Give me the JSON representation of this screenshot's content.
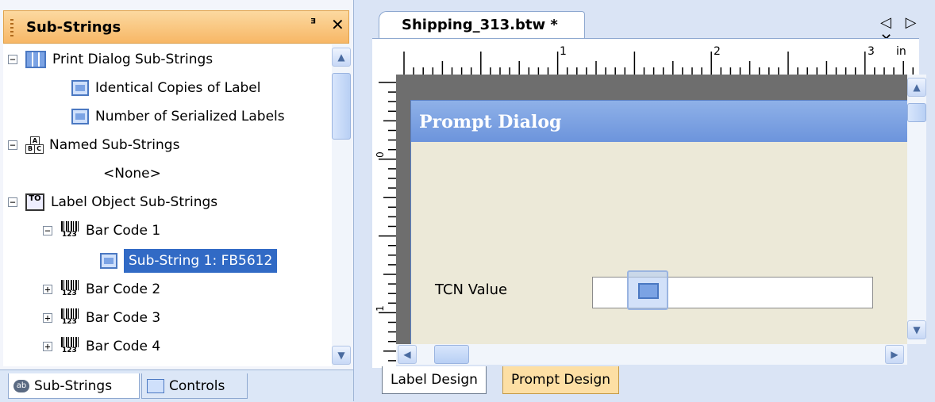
{
  "panel": {
    "title": "Sub-Strings",
    "pin_glyph": "ɰ",
    "close_glyph": "✕"
  },
  "tree": {
    "items": [
      {
        "label": "Print Dialog Sub-Strings",
        "icon": "print-dialog-icon",
        "expander": "−"
      },
      {
        "label": "Identical Copies of Label",
        "icon": "substring-doc-icon"
      },
      {
        "label": "Number of Serialized Labels",
        "icon": "substring-doc-icon"
      },
      {
        "label": "Named Sub-Strings",
        "icon": "abc-blocks-icon",
        "expander": "−"
      },
      {
        "label": "<None>"
      },
      {
        "label": "Label Object Sub-Strings",
        "icon": "label-object-icon",
        "expander": "−"
      },
      {
        "label": "Bar Code 1",
        "icon": "barcode-icon",
        "expander": "−"
      },
      {
        "label": "Sub-String 1: FB5612",
        "icon": "substring-doc-icon",
        "selected": true
      },
      {
        "label": "Bar Code 2",
        "icon": "barcode-icon",
        "expander": "+"
      },
      {
        "label": "Bar Code 3",
        "icon": "barcode-icon",
        "expander": "+"
      },
      {
        "label": "Bar Code 4",
        "icon": "barcode-icon",
        "expander": "+"
      }
    ]
  },
  "bottom_tabs": {
    "substrings": "Sub-Strings",
    "substrings_icon_text": "ab",
    "controls": "Controls"
  },
  "document": {
    "tab_label": "Shipping_313.btw *",
    "nav_arrows": "◁ ▷ ✕",
    "ruler_unit": "in",
    "ruler_numbers": [
      "1",
      "2",
      "3"
    ],
    "ruler_left_numbers": [
      "0",
      "1"
    ]
  },
  "dialog": {
    "title": "Prompt Dialog",
    "field_label": "TCN Value"
  },
  "design_tabs": {
    "label_design": "Label Design",
    "prompt_design": "Prompt Design"
  },
  "colors": {
    "selection": "#316ac5",
    "header_orange": "#f7b766",
    "dialog_title": "#6c94dc"
  }
}
